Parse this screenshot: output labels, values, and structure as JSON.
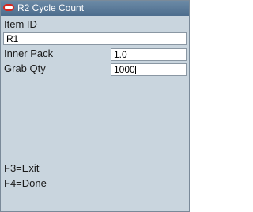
{
  "window": {
    "title": "R2 Cycle Count"
  },
  "form": {
    "item_id_label": "Item ID",
    "item_id_value": "R1",
    "inner_pack_label": "Inner Pack",
    "inner_pack_value": "1.0",
    "grab_qty_label": "Grab Qty",
    "grab_qty_value": "1000"
  },
  "footer": {
    "exit_key": "F3=Exit",
    "done_key": "F4=Done"
  },
  "colors": {
    "title_bar": "#4d6d8d",
    "background": "#c9d5de",
    "logo_red": "#d7261e"
  },
  "icons": {
    "logo": "oracle-logo-icon"
  }
}
